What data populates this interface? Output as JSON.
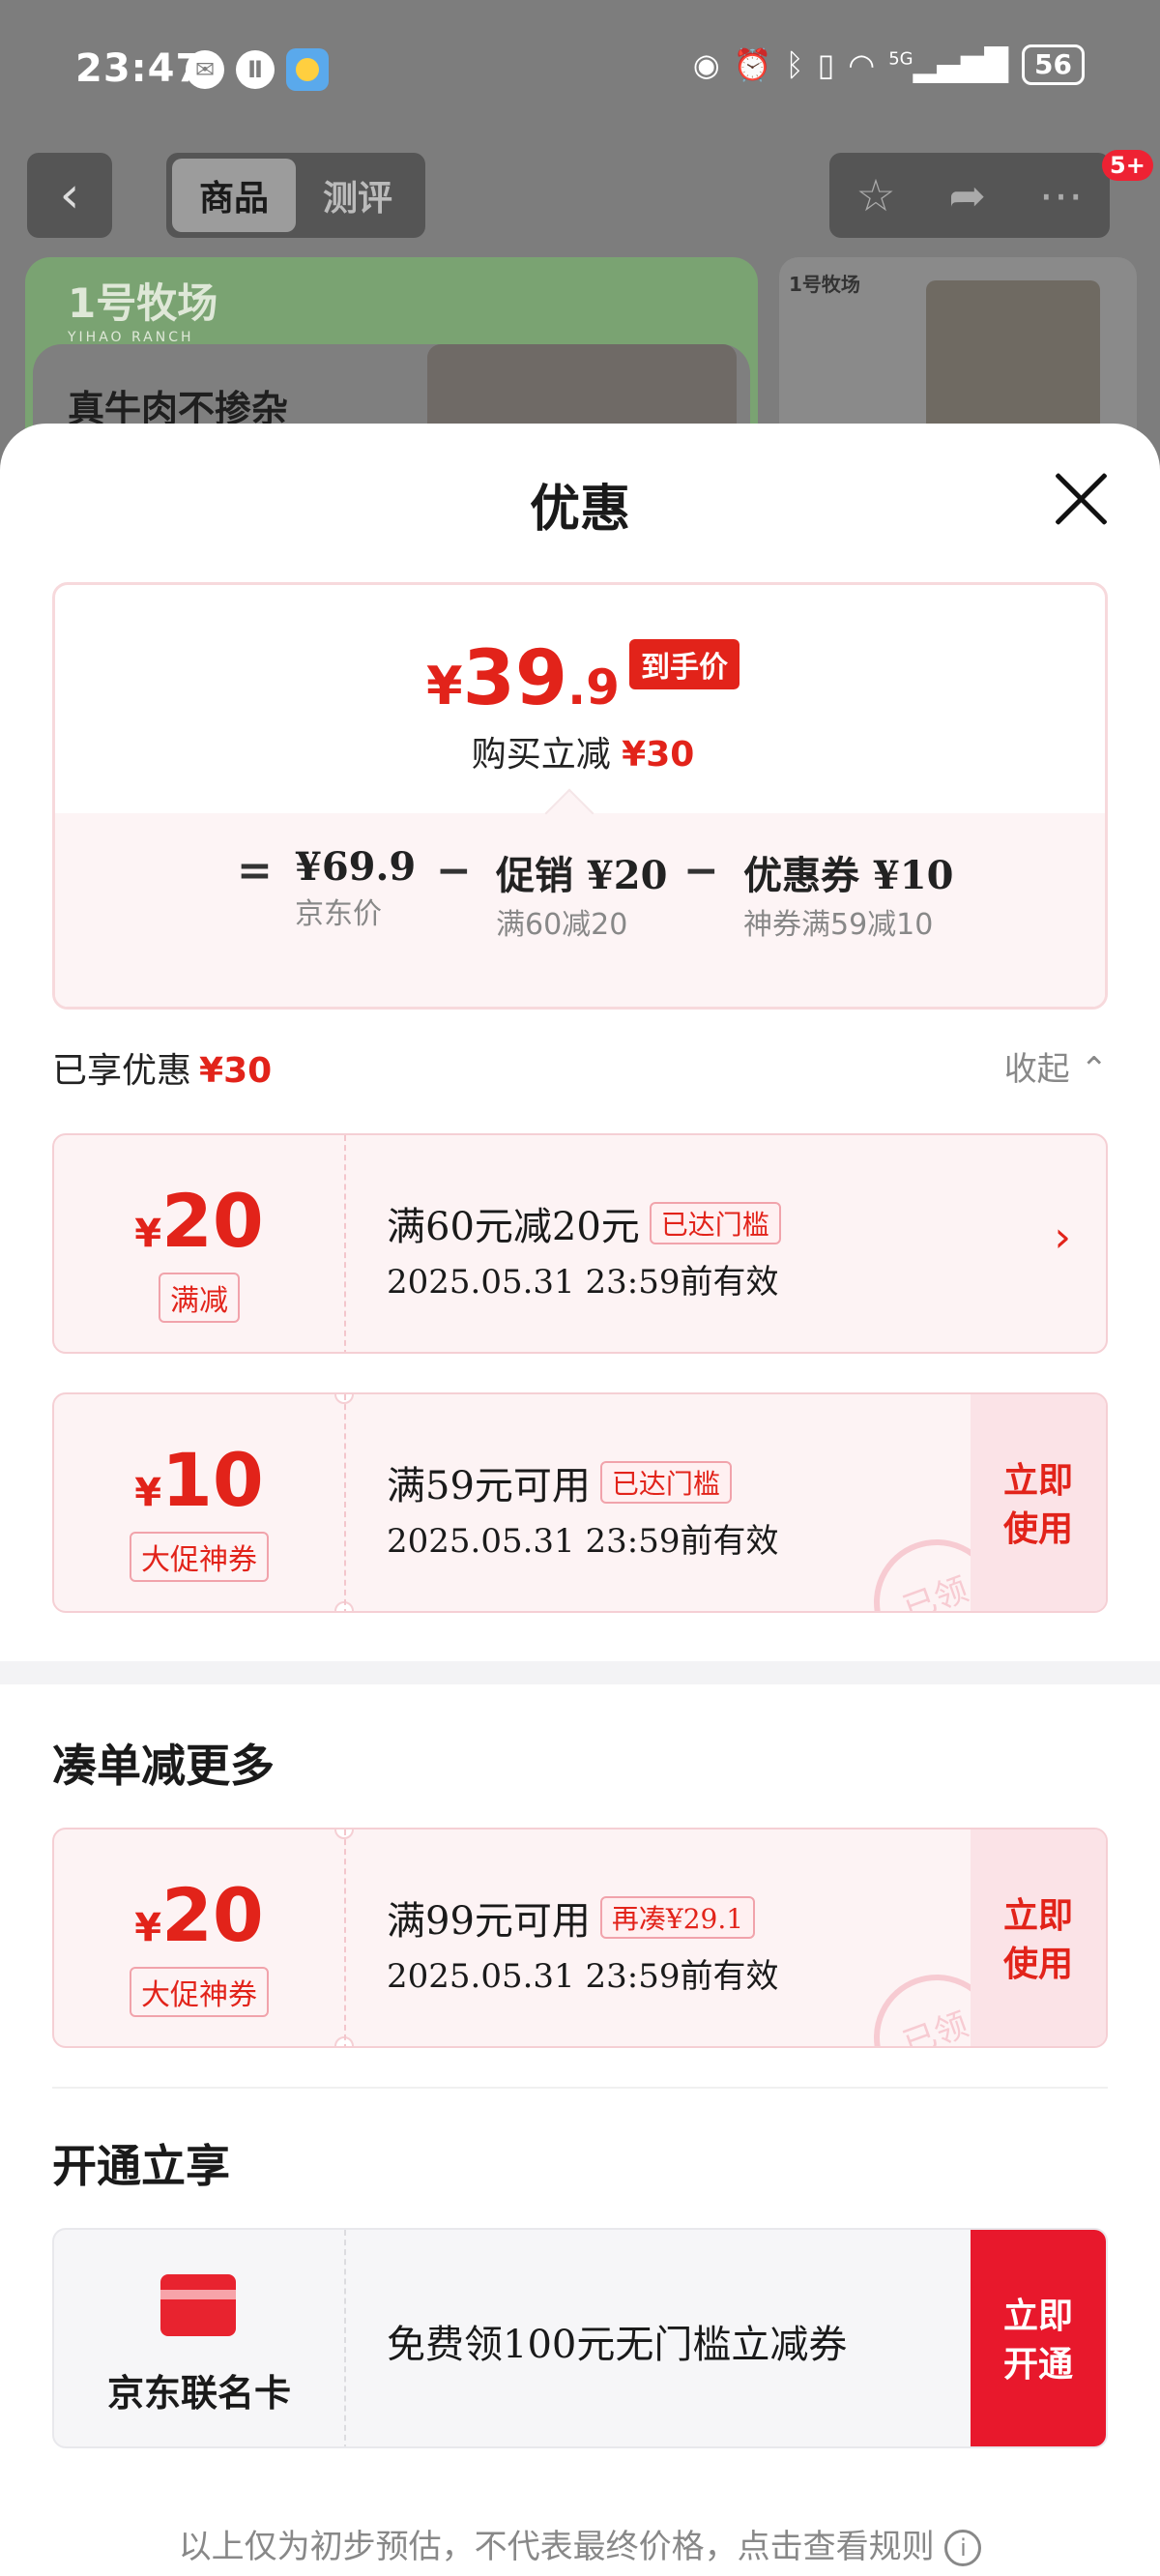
{
  "status_bar": {
    "time": "23:47",
    "network": "5G",
    "battery": "56"
  },
  "nav": {
    "tabs": [
      {
        "label": "商品"
      },
      {
        "label": "测评"
      }
    ],
    "badge": "5+"
  },
  "banner": {
    "logo": "1号牧场",
    "logo_en": "YIHAO RANCH",
    "text": "真牛肉不掺杂",
    "side_label": "1号牧场"
  },
  "sheet": {
    "title": "优惠",
    "final_price": {
      "currency": "¥",
      "integer": "39",
      "decimal": ".9",
      "tag": "到手价"
    },
    "reduction": {
      "label": "购买立减",
      "amount": "¥30"
    },
    "breakdown": [
      {
        "operator": "=",
        "main": "¥69.9",
        "sub": "京东价"
      },
      {
        "operator": "−",
        "main": "促销 ¥20",
        "sub": "满60减20"
      },
      {
        "operator": "−",
        "main": "优惠券 ¥10",
        "sub": "神券满59减10"
      }
    ],
    "enjoyed": {
      "label": "已享优惠",
      "amount": "¥30",
      "collapse": "收起"
    },
    "coupons_applied": [
      {
        "currency": "¥",
        "amount": "20",
        "tag": "满减",
        "title": "满60元减20元",
        "badge": "已达门槛",
        "validity": "2025.05.31 23:59前有效"
      },
      {
        "currency": "¥",
        "amount": "10",
        "tag": "大促神券",
        "title": "满59元可用",
        "badge": "已达门槛",
        "validity": "2025.05.31 23:59前有效",
        "action": "立即使用",
        "stamp": "已领"
      }
    ],
    "more_section": {
      "title": "凑单减更多"
    },
    "coupons_more": [
      {
        "currency": "¥",
        "amount": "20",
        "tag": "大促神券",
        "title": "满99元可用",
        "badge": "再凑¥29.1",
        "validity": "2025.05.31 23:59前有效",
        "action": "立即使用",
        "stamp": "已领"
      }
    ],
    "open_section": {
      "title": "开通立享"
    },
    "card_offer": {
      "name": "京东联名卡",
      "description": "免费领100元无门槛立减券",
      "action": "立即开通"
    },
    "footer": "以上仅为初步预估，不代表最终价格，点击查看规则"
  },
  "colors": {
    "accent": "#e2231a",
    "coupon_bg": "#fdf3f4",
    "overlay": "#7d7d7d"
  }
}
